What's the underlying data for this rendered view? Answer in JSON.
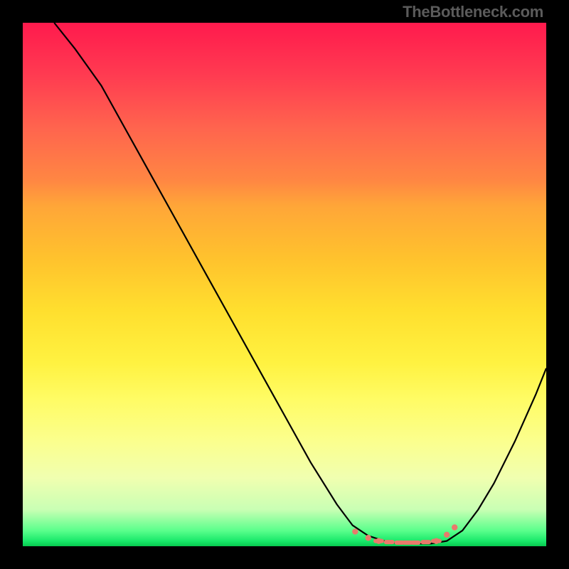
{
  "watermark": "TheBottleneck.com",
  "chart_data": {
    "type": "line",
    "title": "",
    "xlabel": "",
    "ylabel": "",
    "xlim": [
      0,
      100
    ],
    "ylim": [
      0,
      100
    ],
    "series": [
      {
        "name": "bottleneck-curve",
        "x": [
          6,
          10,
          15,
          20,
          25,
          30,
          35,
          40,
          45,
          50,
          55,
          60,
          63,
          66,
          69,
          72,
          75,
          78,
          81,
          84,
          87,
          90,
          94,
          98,
          100
        ],
        "y": [
          100,
          95,
          88,
          79,
          70,
          61,
          52,
          43,
          34,
          25,
          16,
          8,
          4,
          2,
          1,
          0.5,
          0.5,
          0.5,
          1,
          3,
          7,
          12,
          20,
          29,
          34
        ]
      }
    ],
    "zone": {
      "name": "optimal-zone-markers",
      "points_x": [
        63.5,
        66,
        68,
        70,
        72,
        73.5,
        75,
        77,
        79,
        81,
        82.5
      ],
      "points_y": [
        2.8,
        1.6,
        1.0,
        0.8,
        0.7,
        0.7,
        0.7,
        0.8,
        1.0,
        2.2,
        3.6
      ]
    },
    "colors": {
      "background_top": "#ff1a4d",
      "background_bottom": "#07c94f",
      "curve": "#000000",
      "marker": "#e97a6b",
      "frame": "#000000",
      "watermark": "#5b5b5b"
    }
  }
}
